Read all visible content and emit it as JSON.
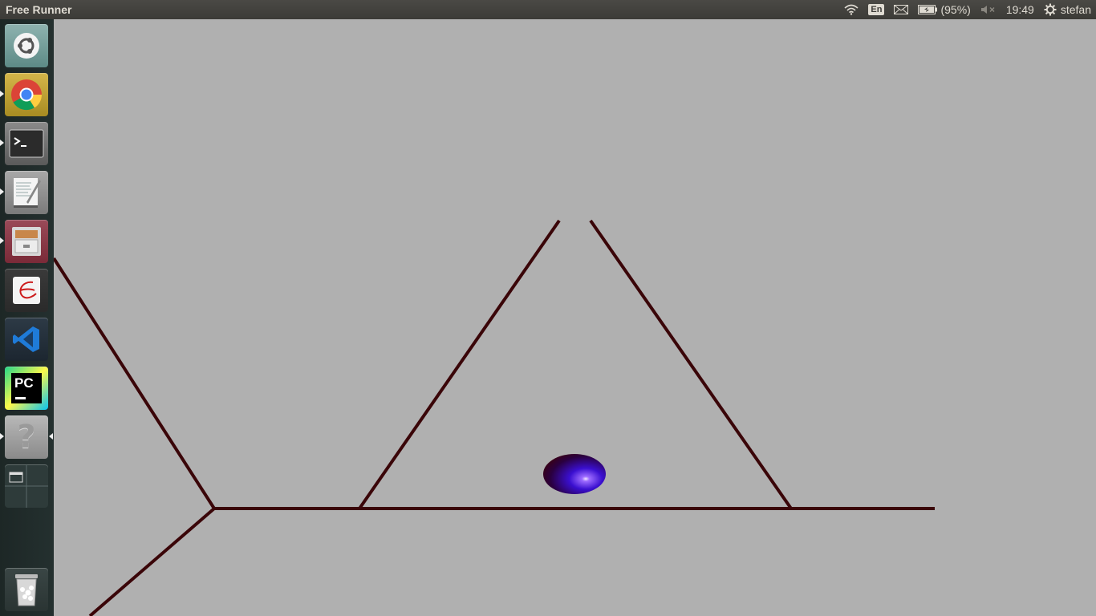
{
  "topbar": {
    "app_title": "Free Runner",
    "keyboard_layout": "En",
    "battery_text": "(95%)",
    "clock": "19:49",
    "user": "stefan"
  },
  "launcher": {
    "items": [
      {
        "name": "ubuntu-dash",
        "icon": "ubuntu-logo-icon"
      },
      {
        "name": "google-chrome",
        "icon": "chrome-icon"
      },
      {
        "name": "terminal",
        "icon": "terminal-icon"
      },
      {
        "name": "text-editor",
        "icon": "text-editor-icon"
      },
      {
        "name": "file-manager",
        "icon": "file-cabinet-icon"
      },
      {
        "name": "evince",
        "icon": "document-viewer-icon"
      },
      {
        "name": "vscode",
        "icon": "vscode-icon"
      },
      {
        "name": "pycharm",
        "icon": "pycharm-icon",
        "label": "PC"
      },
      {
        "name": "unknown-app",
        "icon": "question-mark-icon",
        "label": "?"
      },
      {
        "name": "workspace-switcher",
        "icon": "workspace-switcher-icon"
      },
      {
        "name": "trash",
        "icon": "trash-icon"
      }
    ]
  },
  "game": {
    "colors": {
      "background": "#b0b0b0",
      "track_lines": "#3a0508",
      "ball_dark": "#2a0010",
      "ball_light": "#5a2bff"
    }
  }
}
